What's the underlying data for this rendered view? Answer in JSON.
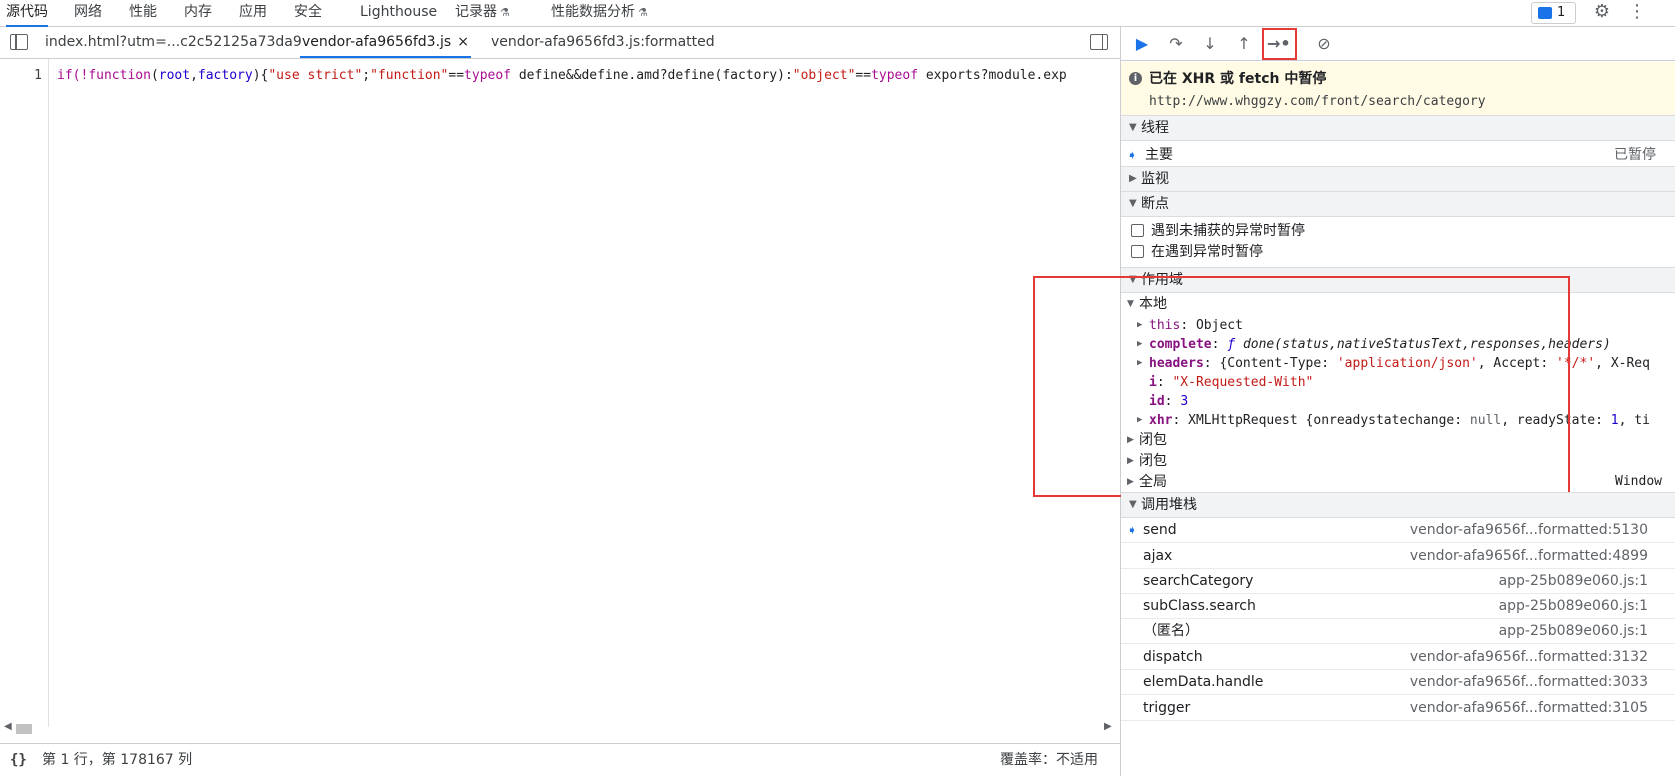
{
  "top_tabs": [
    {
      "label": "源代码",
      "active": true
    },
    {
      "label": "网络"
    },
    {
      "label": "性能"
    },
    {
      "label": "内存"
    },
    {
      "label": "应用"
    },
    {
      "label": "安全"
    },
    {
      "label": "Lighthouse"
    },
    {
      "label": "记录器"
    },
    {
      "label": "性能数据分析"
    }
  ],
  "issues_count": "1",
  "file_tabs": [
    {
      "label": "index.html?utm=...c2c52125a73da9"
    },
    {
      "label": "vendor-afa9656fd3.js",
      "active": true,
      "close": "×"
    },
    {
      "label": "vendor-afa9656fd3.js:formatted"
    }
  ],
  "editor": {
    "line_number": "1",
    "code_segments": [
      {
        "t": "if(!",
        "c": "kw"
      },
      {
        "t": "function",
        "c": "kw"
      },
      {
        "t": "(",
        "c": ""
      },
      {
        "t": "root",
        "c": "var"
      },
      {
        "t": ",",
        "c": ""
      },
      {
        "t": "factory",
        "c": "var"
      },
      {
        "t": "){",
        "c": ""
      },
      {
        "t": "\"use strict\"",
        "c": "str"
      },
      {
        "t": ";",
        "c": ""
      },
      {
        "t": "\"function\"",
        "c": "str"
      },
      {
        "t": "==",
        "c": ""
      },
      {
        "t": "typeof",
        "c": "kw"
      },
      {
        "t": " define&&define.amd?define(factory):",
        "c": ""
      },
      {
        "t": "\"object\"",
        "c": "str"
      },
      {
        "t": "==",
        "c": ""
      },
      {
        "t": "typeof",
        "c": "kw"
      },
      {
        "t": " exports?module.exp",
        "c": ""
      }
    ]
  },
  "status": {
    "braces": "{}",
    "position": "第 1 行，第 178167 列",
    "coverage": "覆盖率：不适用"
  },
  "paused": {
    "title": "已在 XHR 或 fetch 中暂停",
    "url": "http://www.whggzy.com/front/search/category"
  },
  "threads": {
    "header": "线程",
    "main_label": "主要",
    "main_state": "已暂停"
  },
  "watch": {
    "header": "监视"
  },
  "breakpoints": {
    "header": "断点",
    "opt1": "遇到未捕获的异常时暂停",
    "opt2": "在遇到异常时暂停"
  },
  "scope": {
    "header": "作用域",
    "local": "本地",
    "this_key": "this",
    "this_val": "Object",
    "complete_key": "complete",
    "complete_f": "ƒ",
    "complete_val": "done(status,nativeStatusText,responses,headers)",
    "headers_key": "headers",
    "headers_val_a": "{Content-Type: ",
    "headers_val_b": "'application/json'",
    "headers_val_c": ", Accept: ",
    "headers_val_d": "'*/*'",
    "headers_val_e": ", X-Req",
    "i_key": "i",
    "i_val": "\"X-Requested-With\"",
    "id_key": "id",
    "id_val": "3",
    "xhr_key": "xhr",
    "xhr_val_a": "XMLHttpRequest {onreadystatechange: ",
    "xhr_val_b": "null",
    "xhr_val_c": ", readyState: ",
    "xhr_val_d": "1",
    "xhr_val_e": ", ti",
    "closure1": "闭包",
    "closure2": "闭包",
    "global": "全局",
    "global_val": "Window"
  },
  "callstack": {
    "header": "调用堆栈",
    "frames": [
      {
        "fn": "send",
        "loc": "vendor-afa9656f...formatted:5130",
        "current": true
      },
      {
        "fn": "ajax",
        "loc": "vendor-afa9656f...formatted:4899"
      },
      {
        "fn": "searchCategory",
        "loc": "app-25b089e060.js:1"
      },
      {
        "fn": "subClass.search",
        "loc": "app-25b089e060.js:1"
      },
      {
        "fn": "（匿名）",
        "loc": "app-25b089e060.js:1"
      },
      {
        "fn": "dispatch",
        "loc": "vendor-afa9656f...formatted:3132"
      },
      {
        "fn": "elemData.handle",
        "loc": "vendor-afa9656f...formatted:3033"
      },
      {
        "fn": "trigger",
        "loc": "vendor-afa9656f...formatted:3105"
      }
    ]
  }
}
